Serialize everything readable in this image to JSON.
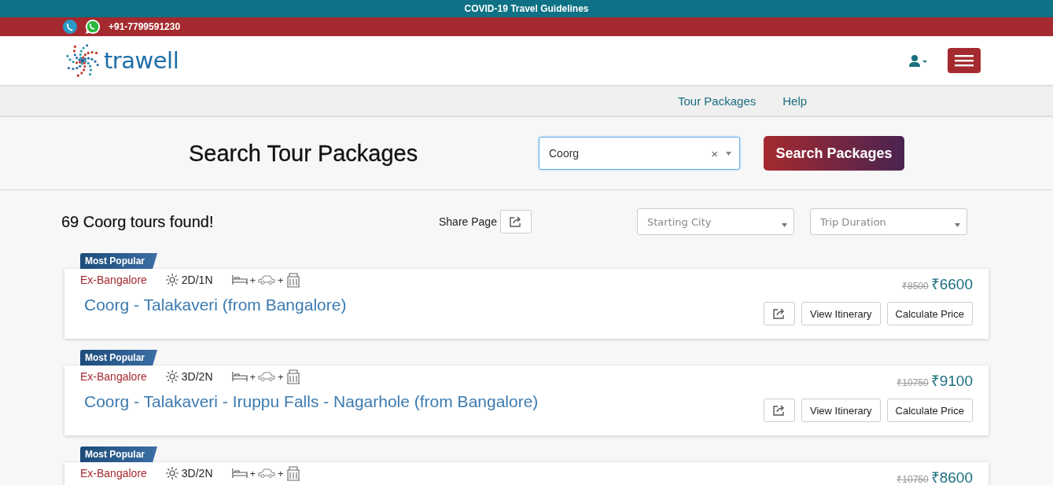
{
  "top_banner": {
    "link": "COVID-19 Travel Guidelines"
  },
  "contact_bar": {
    "phone": "+91-7799591230"
  },
  "header": {
    "logo_text": "trawell"
  },
  "nav": {
    "items": [
      "Tour Packages",
      "Help"
    ]
  },
  "search": {
    "title": "Search Tour Packages",
    "value": "Coorg",
    "clear": "×",
    "button": "Search Packages"
  },
  "results": {
    "count_text": "69 Coorg tours found!",
    "share_label": "Share Page",
    "filters": [
      {
        "placeholder": "Starting City"
      },
      {
        "placeholder": "Trip Duration"
      }
    ]
  },
  "packages": [
    {
      "badge": "Most Popular",
      "origin": "Ex-Bangalore",
      "duration": "2D/1N",
      "inclusions": [
        {
          "kind": "hotel"
        },
        {
          "kind": "car"
        },
        {
          "kind": "sightseeing"
        }
      ],
      "joiner": "+",
      "title": "Coorg - Talakaveri (from Bangalore)",
      "old_price": "₹8500",
      "price": "₹6600",
      "buttons": [
        "View Itinerary",
        "Calculate Price"
      ]
    },
    {
      "badge": "Most Popular",
      "origin": "Ex-Bangalore",
      "duration": "3D/2N",
      "inclusions": [
        {
          "kind": "hotel"
        },
        {
          "kind": "car"
        },
        {
          "kind": "sightseeing"
        }
      ],
      "joiner": "+",
      "title": "Coorg - Talakaveri - Iruppu Falls - Nagarhole (from Bangalore)",
      "old_price": "₹10750",
      "price": "₹9100",
      "buttons": [
        "View Itinerary",
        "Calculate Price"
      ]
    },
    {
      "badge": "Most Popular",
      "origin": "Ex-Bangalore",
      "duration": "3D/2N",
      "inclusions": [
        {
          "kind": "hotel"
        },
        {
          "kind": "car"
        },
        {
          "kind": "sightseeing"
        }
      ],
      "joiner": "+",
      "old_price": "₹10750",
      "price": "₹8600"
    }
  ]
}
